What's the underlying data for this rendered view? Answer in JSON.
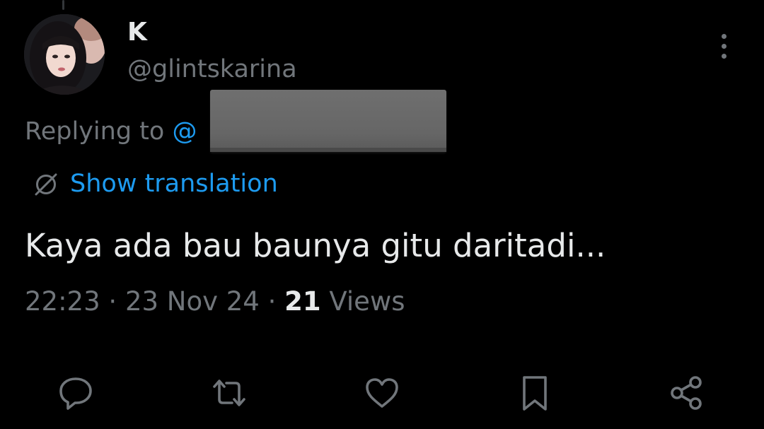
{
  "tweet": {
    "display_name": "K",
    "handle": "@glintskarina",
    "replying_to_prefix": "Replying to",
    "replying_to_at": "@",
    "show_translation": "Show translation",
    "text": "Kaya ada bau baunya gitu daritadi...",
    "time": "22:23",
    "separator": "·",
    "date": "23 Nov 24",
    "views_count": "21",
    "views_label": "Views"
  },
  "icons": {
    "more": "more-vertical-icon",
    "translate": "translate-icon",
    "reply": "reply-icon",
    "retweet": "retweet-icon",
    "like": "like-icon",
    "bookmark": "bookmark-icon",
    "share": "share-icon"
  },
  "colors": {
    "background": "#000000",
    "primary_text": "#e7e9ea",
    "secondary_text": "#71767b",
    "link": "#1d9bf0",
    "redaction": "#666666"
  }
}
